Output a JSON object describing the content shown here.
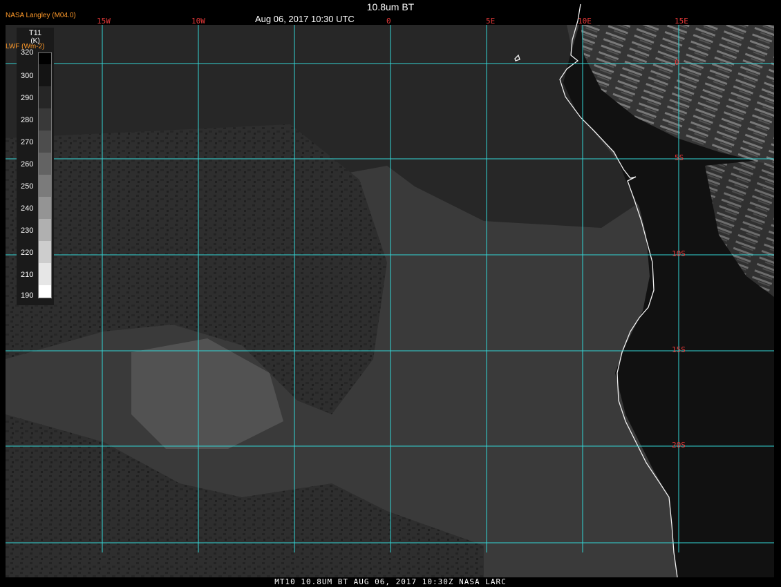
{
  "header": {
    "title": "10.8um BT",
    "datetime": "Aug 06, 2017 10:30 UTC",
    "brand": "NASA Langley (M04.0)"
  },
  "legend": {
    "variable": "T11",
    "unit": "(K)",
    "secondary_label": "LWF (Wm-2)",
    "ticks": [
      "320",
      "300",
      "290",
      "280",
      "270",
      "260",
      "250",
      "240",
      "230",
      "220",
      "210",
      "190"
    ]
  },
  "grid": {
    "longitudes": [
      "15W",
      "10W",
      "0",
      "5E",
      "10E",
      "15E"
    ],
    "latitudes": [
      "0",
      "5S",
      "10S",
      "15S",
      "20S"
    ]
  },
  "footer": {
    "caption": "MT10  10.8UM BT  AUG 06, 2017 10:30Z  NASA LARC"
  },
  "colors": {
    "gridline": "#33d6d6",
    "grid_label": "#e83a3a",
    "brand": "#ff9a2a",
    "text": "#ffffff",
    "land": "#101010",
    "ocean": "#3a3a3a"
  }
}
